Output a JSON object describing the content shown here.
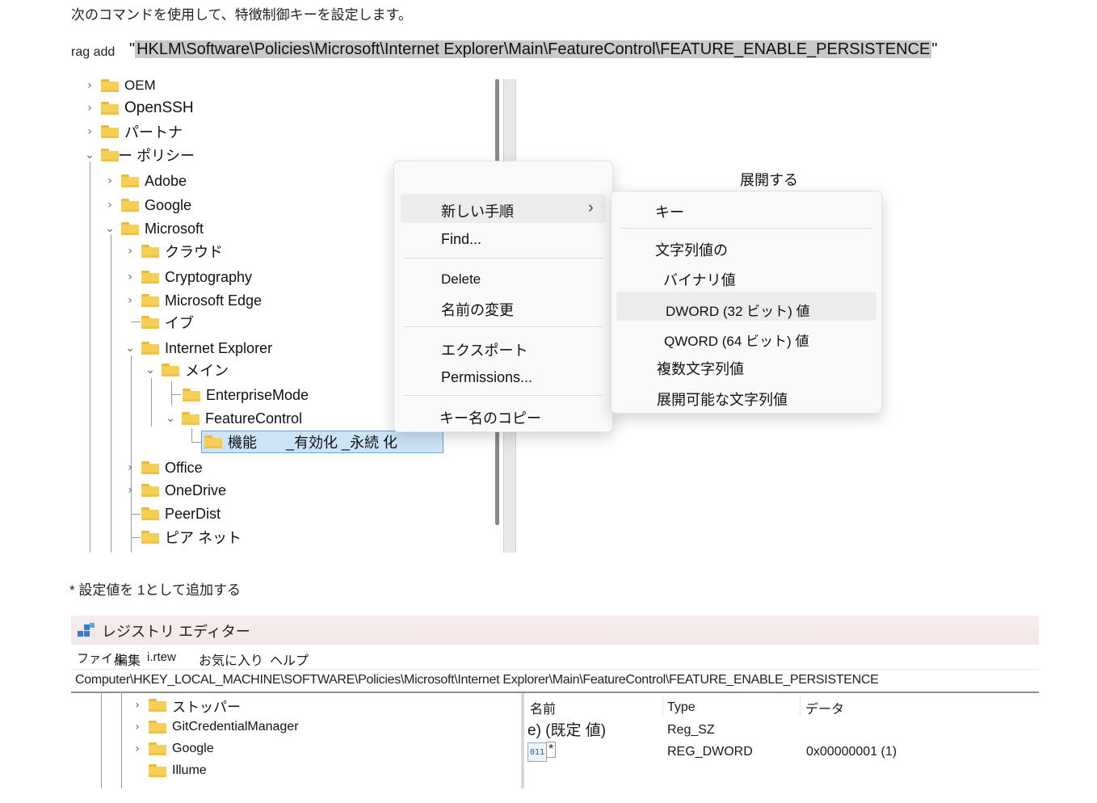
{
  "intro_text": "次のコマンドを使用して、特徴制御キーを設定します。",
  "command": {
    "prefix": "rag add",
    "open_quote": "\"",
    "path": "HKLM\\Software\\Policies\\Microsoft\\Internet Explorer\\Main\\FeatureControl\\FEATURE_ENABLE_PERSISTENCE",
    "close_quote": "\""
  },
  "tree": {
    "items": [
      {
        "label": "OEM",
        "chevron": "right"
      },
      {
        "label": "OpenSSH",
        "chevron": "right"
      },
      {
        "label": "パートナ",
        "chevron": "right"
      },
      {
        "label": "ー ポリシー",
        "chevron": "down"
      },
      {
        "label": "Adobe",
        "chevron": "right"
      },
      {
        "label": "Google",
        "chevron": "right"
      },
      {
        "label": "Microsoft",
        "chevron": "down"
      },
      {
        "label": "クラウド",
        "chevron": "right"
      },
      {
        "label": "Cryptography",
        "chevron": "right"
      },
      {
        "label": "Microsoft Edge",
        "chevron": "right"
      },
      {
        "label": "イブ",
        "chevron": "none"
      },
      {
        "label": "Internet Explorer",
        "chevron": "down"
      },
      {
        "label": "メイン",
        "chevron": "down"
      },
      {
        "label": "EnterpriseMode",
        "chevron": "none"
      },
      {
        "label": "FeatureControl",
        "chevron": "down"
      },
      {
        "label": "機能　　_有効化 _永続 化",
        "chevron": "none"
      },
      {
        "label": "Office",
        "chevron": "right"
      },
      {
        "label": "OneDrive",
        "chevron": "right"
      },
      {
        "label": "PeerDist",
        "chevron": "none"
      },
      {
        "label": "ピア ネット",
        "chevron": "none"
      }
    ]
  },
  "context_menu": {
    "items": [
      {
        "label": "新しい手順",
        "submenu_arrow": "›"
      },
      {
        "label": "Find..."
      },
      {
        "label": "Delete"
      },
      {
        "label": "名前の変更"
      },
      {
        "label": "エクスポート"
      },
      {
        "label": "Permissions..."
      },
      {
        "label": "キー名のコピー"
      }
    ]
  },
  "submenu": {
    "header": "展開する",
    "items": [
      {
        "label": "キー"
      },
      {
        "label": "文字列値の"
      },
      {
        "label": "バイナリ値"
      },
      {
        "label": "DWORD (32 ビット) 値"
      },
      {
        "label": "QWORD (64 ビット) 値"
      },
      {
        "label": "複数文字列値"
      },
      {
        "label": "展開可能な文字列値"
      }
    ]
  },
  "note": "* 設定値を 1として追加する",
  "registry_editor": {
    "title": "レジストリ エディター",
    "menu": [
      "ファイル",
      "編集",
      "i.rtew",
      "お気に入り",
      "ヘルプ"
    ],
    "address": "Computer\\HKEY_LOCAL_MACHINE\\SOFTWARE\\Policies\\Microsoft\\Internet Explorer\\Main\\FeatureControl\\FEATURE_ENABLE_PERSISTENCE",
    "tree": [
      {
        "label": "ストッパー"
      },
      {
        "label": "GitCredentialManager"
      },
      {
        "label": "Google"
      },
      {
        "label": "Illume"
      }
    ],
    "columns": {
      "name": "名前",
      "type": "Type",
      "data": "データ"
    },
    "rows": [
      {
        "name": "e) (既定 値)",
        "type": "Reg_SZ",
        "data": ""
      },
      {
        "name": "*",
        "type": "REG_DWORD",
        "data": "0x00000001 (1)"
      }
    ]
  },
  "colors": {
    "folder": "#f6cf57",
    "selection": "#cde4f7",
    "menu_bg": "#f9f9f9"
  }
}
